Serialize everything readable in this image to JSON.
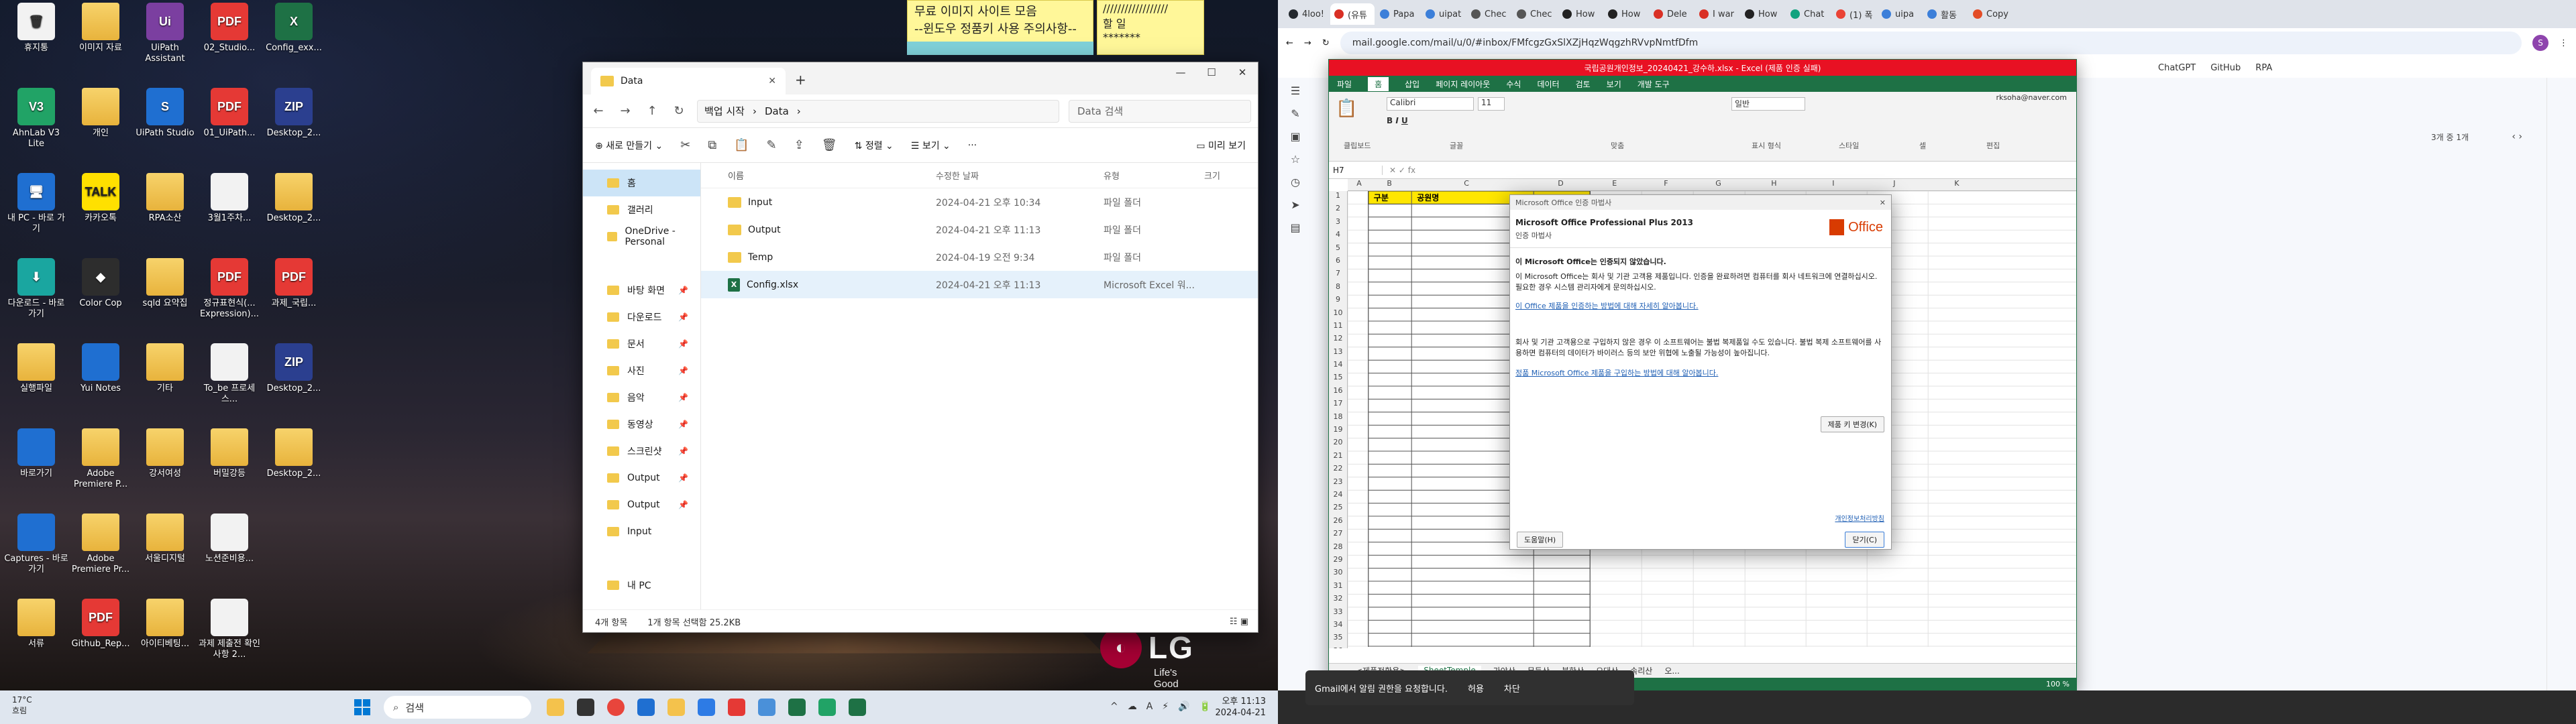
{
  "desktop": {
    "icons": [
      {
        "label": "휴지통",
        "glyph": "🗑",
        "style": "white",
        "col": 0,
        "row": 0
      },
      {
        "label": "이미지 자료",
        "glyph": "",
        "style": "folder",
        "col": 1,
        "row": 0
      },
      {
        "label": "UiPath Assistant",
        "glyph": "Ui",
        "style": "purple",
        "col": 2,
        "row": 0
      },
      {
        "label": "02_Studio...",
        "glyph": "PDF",
        "style": "pdf",
        "col": 3,
        "row": 0
      },
      {
        "label": "Config_exx...",
        "glyph": "X",
        "style": "xls",
        "col": 4,
        "row": 0
      },
      {
        "label": "AhnLab V3 Lite",
        "glyph": "V3",
        "style": "green",
        "col": 0,
        "row": 1
      },
      {
        "label": "개인",
        "glyph": "",
        "style": "folder",
        "col": 1,
        "row": 1
      },
      {
        "label": "UiPath Studio",
        "glyph": "S",
        "style": "blue",
        "col": 2,
        "row": 1
      },
      {
        "label": "01_UiPath...",
        "glyph": "PDF",
        "style": "pdf",
        "col": 3,
        "row": 1
      },
      {
        "label": "Desktop_2...",
        "glyph": "ZIP",
        "style": "navy",
        "col": 4,
        "row": 1
      },
      {
        "label": "내 PC - 바로 가기",
        "glyph": "🖥",
        "style": "blue",
        "col": 0,
        "row": 2
      },
      {
        "label": "카카오톡",
        "glyph": "TALK",
        "style": "yellow",
        "col": 1,
        "row": 2
      },
      {
        "label": "RPA소산",
        "glyph": "",
        "style": "folder",
        "col": 2,
        "row": 2
      },
      {
        "label": "3월1주차...",
        "glyph": "",
        "style": "white",
        "col": 3,
        "row": 2
      },
      {
        "label": "Desktop_2...",
        "glyph": "",
        "style": "folder",
        "col": 4,
        "row": 2
      },
      {
        "label": "다운로드 - 바로 가기",
        "glyph": "⬇",
        "style": "teal",
        "col": 0,
        "row": 3
      },
      {
        "label": "Color Cop",
        "glyph": "◆",
        "style": "dark",
        "col": 1,
        "row": 3
      },
      {
        "label": "sqld 요약집",
        "glyph": "",
        "style": "folder",
        "col": 2,
        "row": 3
      },
      {
        "label": "정규표현식(... Expression)...",
        "glyph": "PDF",
        "style": "pdf",
        "col": 3,
        "row": 3
      },
      {
        "label": "과제_국립...",
        "glyph": "PDF",
        "style": "pdf",
        "col": 4,
        "row": 3
      },
      {
        "label": "실행파일",
        "glyph": "",
        "style": "folder",
        "col": 0,
        "row": 4
      },
      {
        "label": "Yui Notes",
        "glyph": "",
        "style": "blue",
        "col": 1,
        "row": 4
      },
      {
        "label": "기타",
        "glyph": "",
        "style": "folder",
        "col": 2,
        "row": 4
      },
      {
        "label": "To_be 프로세스...",
        "glyph": "",
        "style": "white",
        "col": 3,
        "row": 4
      },
      {
        "label": "Desktop_2...",
        "glyph": "ZIP",
        "style": "navy",
        "col": 4,
        "row": 4
      },
      {
        "label": "바로가기",
        "glyph": "",
        "style": "blue",
        "col": 0,
        "row": 5
      },
      {
        "label": "Adobe Premiere P...",
        "glyph": "",
        "style": "folder",
        "col": 1,
        "row": 5
      },
      {
        "label": "강서여성",
        "glyph": "",
        "style": "folder",
        "col": 2,
        "row": 5
      },
      {
        "label": "버밀강등",
        "glyph": "",
        "style": "folder",
        "col": 3,
        "row": 5
      },
      {
        "label": "Desktop_2...",
        "glyph": "",
        "style": "folder",
        "col": 4,
        "row": 5
      },
      {
        "label": "Captures - 바로 가기",
        "glyph": "",
        "style": "blue",
        "col": 0,
        "row": 6
      },
      {
        "label": "Adobe Premiere Pr...",
        "glyph": "",
        "style": "folder",
        "col": 1,
        "row": 6
      },
      {
        "label": "서울디지털",
        "glyph": "",
        "style": "folder",
        "col": 2,
        "row": 6
      },
      {
        "label": "노션준비용...",
        "glyph": "",
        "style": "white",
        "col": 3,
        "row": 6
      },
      {
        "label": "서류",
        "glyph": "",
        "style": "folder",
        "col": 0,
        "row": 7
      },
      {
        "label": "Github_Rep...",
        "glyph": "PDF",
        "style": "pdf",
        "col": 1,
        "row": 7
      },
      {
        "label": "아이티베팅...",
        "glyph": "",
        "style": "folder",
        "col": 2,
        "row": 7
      },
      {
        "label": "과제 제출전 확인사항 2...",
        "glyph": "",
        "style": "white",
        "col": 3,
        "row": 7
      }
    ],
    "sticky_lines": [
      "무료 이미지 사이트 모음",
      "--윈도우 정품키 사용 주의사항--"
    ],
    "sticky2_lines": [
      "//////////////////",
      "할 일",
      "*******"
    ],
    "brand": {
      "logo": "LG",
      "tagline": "Life's Good"
    }
  },
  "explorer": {
    "tab_title": "Data",
    "breadcrumb": [
      "백업 시작",
      "Data"
    ],
    "search_placeholder": "Data 검색",
    "toolbar": {
      "new": "새로 만들기",
      "sort": "정렬",
      "view": "보기",
      "more": "···",
      "preview": "미리 보기"
    },
    "nav": [
      {
        "label": "홈",
        "sel": true,
        "pin": false
      },
      {
        "label": "갤러리",
        "sel": false,
        "pin": false
      },
      {
        "label": "OneDrive - Personal",
        "sel": false,
        "pin": false
      },
      {
        "label": "",
        "sel": false,
        "pin": false
      },
      {
        "label": "바탕 화면",
        "sel": false,
        "pin": true
      },
      {
        "label": "다운로드",
        "sel": false,
        "pin": true
      },
      {
        "label": "문서",
        "sel": false,
        "pin": true
      },
      {
        "label": "사진",
        "sel": false,
        "pin": true
      },
      {
        "label": "음악",
        "sel": false,
        "pin": true
      },
      {
        "label": "동영상",
        "sel": false,
        "pin": true
      },
      {
        "label": "스크린샷",
        "sel": false,
        "pin": true
      },
      {
        "label": "Output",
        "sel": false,
        "pin": true
      },
      {
        "label": "Output",
        "sel": false,
        "pin": true
      },
      {
        "label": "Input",
        "sel": false,
        "pin": false
      },
      {
        "label": "",
        "sel": false,
        "pin": false
      },
      {
        "label": "내 PC",
        "sel": false,
        "pin": false
      }
    ],
    "columns": [
      "이름",
      "수정한 날짜",
      "유형",
      "크기"
    ],
    "files": [
      {
        "name": "Input",
        "date": "2024-04-21 오후 10:34",
        "type": "파일 폴더",
        "size": "",
        "kind": "folder",
        "sel": false
      },
      {
        "name": "Output",
        "date": "2024-04-21 오후 11:13",
        "type": "파일 폴더",
        "size": "",
        "kind": "folder",
        "sel": false
      },
      {
        "name": "Temp",
        "date": "2024-04-19 오전 9:34",
        "type": "파일 폴더",
        "size": "",
        "kind": "folder",
        "sel": false
      },
      {
        "name": "Config.xlsx",
        "date": "2024-04-21 오후 11:13",
        "type": "Microsoft Excel 워...",
        "size": "",
        "kind": "xlsx",
        "sel": true
      }
    ],
    "status": {
      "count": "4개 항목",
      "selected": "1개 항목 선택함 25.2KB"
    }
  },
  "chrome": {
    "tabs": [
      "4loo!",
      "(유튜",
      "Papa",
      "uipat",
      "Chec",
      "Chec",
      "How",
      "How",
      "Dele",
      "I war",
      "How",
      "Chat",
      "(1) 폭",
      "uipa",
      "활동",
      "Copy"
    ],
    "tab_colors": [
      "#24292f",
      "#d93025",
      "#3c7fd9",
      "#3c7fd9",
      "#555",
      "#555",
      "#222",
      "#222",
      "#d93025",
      "#d93025",
      "#222",
      "#10a37f",
      "#ea4335",
      "#3c7fd9",
      "#3c7fd9",
      "#e34c26"
    ],
    "active_tab": 1,
    "url": "mail.google.com/mail/u/0/#inbox/FMfcgzGxSlXZjHqzWqgzhRVvpNmtfDfm",
    "bookmarks": [
      "ChatGPT",
      "GitHub",
      "RPA"
    ]
  },
  "gmail": {
    "pagination": "3개 중 1개"
  },
  "excel": {
    "title": "국립공원개인정보_20240421_강수하.xlsx - Excel (제품 인증 실패)",
    "user": "rksoha@naver.com",
    "ribbon_tabs": [
      "파일",
      "홈",
      "삽입",
      "페이지 레이아웃",
      "수식",
      "데이터",
      "검토",
      "보기",
      "개발 도구"
    ],
    "font_name": "Calibri",
    "font_size": "11",
    "number_format": "일반",
    "ribbon_groups": [
      "클립보드",
      "글꼴",
      "맞춤",
      "표시 형식",
      "스타일",
      "셀",
      "편집"
    ],
    "name_box": "H7",
    "columns": [
      "A",
      "B",
      "C",
      "D",
      "E",
      "F",
      "G",
      "H",
      "I",
      "J",
      "K"
    ],
    "header_cells": [
      "구분",
      "공원명"
    ],
    "sheets": [
      "<제품전환용>",
      "SheetTemple",
      "가야산",
      "무등산",
      "북한산",
      "오대산",
      "속리산",
      "오..."
    ],
    "active_sheet": 1,
    "zoom": "100 %",
    "status_left": "준비"
  },
  "dialog": {
    "window_title": "Microsoft Office 인증 마법사",
    "product": "Microsoft Office Professional Plus 2013",
    "subtitle": "인증 마법사",
    "heading": "이 Microsoft Office는 인증되지 않았습니다.",
    "para1": "이 Microsoft Office는 회사 및 기관 고객용 제품입니다. 인증을 완료하려면 컴퓨터를 회사 네트워크에 연결하십시오. 필요한 경우 시스템 관리자에게 문의하십시오.",
    "link1": "이 Office 제품을 인증하는 방법에 대해 자세히 알아봅니다.",
    "para2": "회사 및 기관 고객용으로 구입하지 않은 경우 이 소프트웨어는 불법 복제품일 수도 있습니다. 불법 복제 소프트웨어를 사용하면 컴퓨터의 데이터가 바이러스 등의 보안 위협에 노출될 가능성이 높아집니다.",
    "link2": "정품 Microsoft Office 제품을 구입하는 방법에 대해 알아봅니다.",
    "change_key": "제품 키 변경(K)",
    "privacy": "개인정보처리방침",
    "help": "도움말(H)",
    "close": "닫기(C)",
    "office_logo": "Office"
  },
  "taskbar": {
    "weather_temp": "17°C",
    "weather_desc": "흐림",
    "search": "검색",
    "time": "오후 11:13",
    "date": "2024-04-21",
    "tray": [
      "^",
      "☁",
      "A",
      "⚡",
      "🔊",
      "🔋"
    ]
  },
  "toast": {
    "text": "Gmail에서 알림 권한을 요청합니다.",
    "b1": "허용",
    "b2": "차단"
  }
}
